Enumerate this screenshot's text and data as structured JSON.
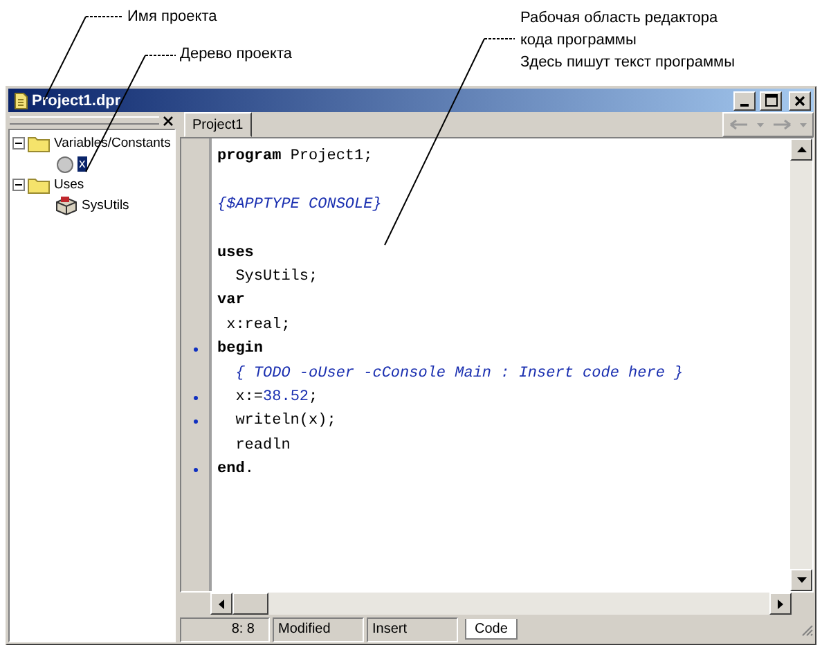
{
  "annotations": [
    {
      "lines": [
        "Имя проекта"
      ]
    },
    {
      "lines": [
        "Дерево проекта"
      ]
    },
    {
      "lines": [
        "Рабочая область редактора",
        "кода программы",
        "Здесь  пишут текст программы"
      ]
    }
  ],
  "window": {
    "title": "Project1.dpr"
  },
  "tree": [
    {
      "label": "Variables/Constants",
      "kind": "folder",
      "expanded": true,
      "selected": false,
      "children": [
        {
          "label": "x",
          "kind": "variable",
          "selected": true
        }
      ]
    },
    {
      "label": "Uses",
      "kind": "folder",
      "expanded": true,
      "selected": false,
      "children": [
        {
          "label": "SysUtils",
          "kind": "unit",
          "selected": false
        }
      ]
    }
  ],
  "tabs": [
    {
      "label": "Project1",
      "selected": true
    }
  ],
  "code": [
    {
      "marker": false,
      "segments": [
        {
          "kind": "keyword",
          "text": "program"
        },
        {
          "kind": "plain",
          "text": " Project1;"
        }
      ]
    },
    {
      "marker": false
    },
    {
      "marker": false,
      "segments": [
        {
          "kind": "comment",
          "text": "{$APPTYPE CONSOLE}"
        }
      ]
    },
    {
      "marker": false
    },
    {
      "marker": false,
      "segments": [
        {
          "kind": "keyword",
          "text": "uses"
        }
      ]
    },
    {
      "marker": false,
      "segments": [
        {
          "kind": "plain",
          "text": "  SysUtils;"
        }
      ]
    },
    {
      "marker": false,
      "segments": [
        {
          "kind": "keyword",
          "text": "var"
        }
      ]
    },
    {
      "marker": false,
      "segments": [
        {
          "kind": "plain",
          "text": " x:real;"
        }
      ]
    },
    {
      "marker": true,
      "segments": [
        {
          "kind": "keyword",
          "text": "begin"
        }
      ]
    },
    {
      "marker": false,
      "segments": [
        {
          "kind": "comment",
          "text": "  { TODO -oUser -cConsole Main : Insert code here }"
        }
      ]
    },
    {
      "marker": true,
      "segments": [
        {
          "kind": "plain",
          "text": "  x:="
        },
        {
          "kind": "number",
          "text": "38.52"
        },
        {
          "kind": "plain",
          "text": ";"
        }
      ]
    },
    {
      "marker": true,
      "segments": [
        {
          "kind": "plain",
          "text": "  writeln(x);"
        }
      ]
    },
    {
      "marker": false,
      "segments": [
        {
          "kind": "plain",
          "text": "  readln"
        }
      ]
    },
    {
      "marker": true,
      "segments": [
        {
          "kind": "keyword",
          "text": "end"
        },
        {
          "kind": "plain",
          "text": "."
        }
      ]
    }
  ],
  "status_bar": {
    "position": "8:  8",
    "modified": "Modified",
    "mode": "Insert",
    "view_tabs": [
      {
        "label": "Code",
        "selected": true
      }
    ]
  }
}
